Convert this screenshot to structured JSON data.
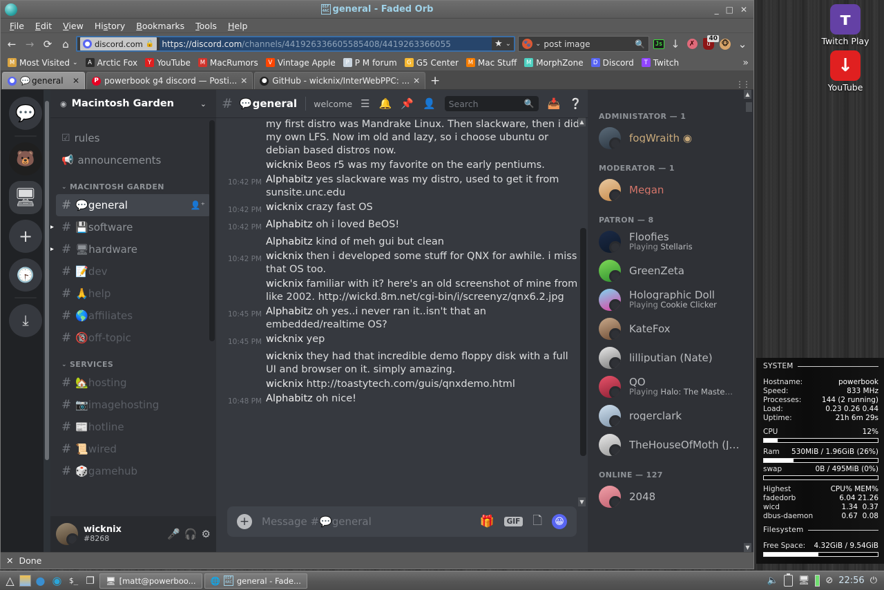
{
  "desktop": {
    "icons": [
      {
        "label": "Twitch Play",
        "icon": "twitch-icon",
        "glyph": "ᴛ"
      },
      {
        "label": "YouTube",
        "icon": "youtube-download-icon",
        "glyph": "↓"
      }
    ]
  },
  "sysmon": {
    "section_system": "SYSTEM",
    "rows": [
      {
        "k": "Hostname:",
        "v": "powerbook"
      },
      {
        "k": "Speed:",
        "v": "833 MHz"
      },
      {
        "k": "Processes:",
        "v": "144 (2 running)"
      },
      {
        "k": "Load:",
        "v": "0.23 0.26 0.44"
      },
      {
        "k": "Uptime:",
        "v": "21h 6m 29s"
      }
    ],
    "cpu_label": "CPU",
    "cpu_value": "12%",
    "cpu_pct": 12,
    "ram_label": "Ram",
    "ram_value": "530MiB / 1.96GiB (26%)",
    "ram_pct": 26,
    "swap_label": "swap",
    "swap_value": "0B / 495MiB (0%)",
    "swap_pct": 0,
    "highest_label": "Highest",
    "highest_cols": "CPU% MEM%",
    "procs": [
      {
        "name": "fadedorb",
        "cpu": "6.04",
        "mem": "21.26"
      },
      {
        "name": "wicd",
        "cpu": "1.34",
        "mem": "0.37"
      },
      {
        "name": "dbus-daemon",
        "cpu": "0.67",
        "mem": "0.08"
      }
    ],
    "section_fs": "Filesystem",
    "free_label": "Free Space:",
    "free_value": "4.32GiB / 9.54GiB",
    "free_pct": 48
  },
  "window": {
    "title": "general - Faded Orb",
    "title_code_top": "01F",
    "title_code_bot": "4AC",
    "minimize": "_",
    "maximize": "□",
    "close": "✕"
  },
  "menubar": {
    "items": [
      {
        "label": "File",
        "accel": "F"
      },
      {
        "label": "Edit",
        "accel": "E"
      },
      {
        "label": "View",
        "accel": "V"
      },
      {
        "label": "History",
        "accel": "s"
      },
      {
        "label": "Bookmarks",
        "accel": "B"
      },
      {
        "label": "Tools",
        "accel": "T"
      },
      {
        "label": "Help",
        "accel": "H"
      }
    ]
  },
  "navbar": {
    "back": "←",
    "forward": "→",
    "reload": "⟳",
    "home": "⌂",
    "site_label": "discord.com",
    "lock_icon": "padlock-icon",
    "url_host": "https://discord.com",
    "url_path": "/channels/441926336605585408/4419263366055",
    "star": "★",
    "dropdown": "⌄",
    "search_value": "post image",
    "search_engine": "duckduckgo-icon",
    "search_icon": "🔍",
    "extensions": [
      {
        "name": "greasemonkey-js-icon",
        "label": "Js"
      },
      {
        "name": "download-arrow-icon",
        "label": "↓"
      },
      {
        "name": "noscript-icon",
        "label": ""
      },
      {
        "name": "ublock-origin-icon",
        "label": "u",
        "badge": "40"
      },
      {
        "name": "monkey-extension-icon",
        "label": ""
      }
    ],
    "overflow": "⌄"
  },
  "bookmarks": [
    {
      "label": "Most Visited",
      "icon": "folder-star-icon",
      "color": "#d9a441",
      "chev": "⌄"
    },
    {
      "label": "Arctic Fox",
      "icon": "arcticfox-icon",
      "color": "#2b2b2b"
    },
    {
      "label": "YouTube",
      "icon": "youtube-icon",
      "color": "#e02020"
    },
    {
      "label": "MacRumors",
      "icon": "macrumors-icon",
      "color": "#d0342c"
    },
    {
      "label": "Vintage Apple",
      "icon": "reddit-icon",
      "color": "#ff4500"
    },
    {
      "label": "P M forum",
      "icon": "powermac-forum-icon",
      "color": "#c9d4de"
    },
    {
      "label": "G5 Center",
      "icon": "g5-center-icon",
      "color": "#f5b731"
    },
    {
      "label": "Mac Stuff",
      "icon": "blogger-icon",
      "color": "#f57c00"
    },
    {
      "label": "MorphZone",
      "icon": "morphzone-icon",
      "color": "#4dd0c0"
    },
    {
      "label": "Discord",
      "icon": "discord-icon",
      "color": "#5865f2"
    },
    {
      "label": "Twitch",
      "icon": "twitch-icon",
      "color": "#9146ff"
    }
  ],
  "bookmarks_overflow": "»",
  "tabs": {
    "items": [
      {
        "label": "general",
        "favicon": "discord-icon",
        "active": true,
        "emoji": "💬"
      },
      {
        "label": "powerbook g4 discord — Posti...",
        "favicon": "pinterest-icon",
        "active": false
      },
      {
        "label": "GitHub - wicknix/InterWebPPC: ...",
        "favicon": "github-icon",
        "active": false
      }
    ],
    "close": "✕",
    "new_tab": "+"
  },
  "discord": {
    "rail": [
      {
        "name": "home-button",
        "icon": "discord-logo-icon"
      },
      {
        "name": "guild-macyn",
        "icon": "macyn-server-icon"
      },
      {
        "name": "guild-macintosh-garden",
        "icon": "macintosh-garden-server-icon",
        "selected": true
      },
      {
        "name": "add-server-button",
        "icon": "plus-icon",
        "glyph": "+"
      },
      {
        "name": "explore-servers-button",
        "icon": "compass-icon",
        "glyph": "⦿"
      },
      {
        "name": "download-apps-button",
        "icon": "download-icon",
        "glyph": "⤓"
      }
    ],
    "guild_name": "Macintosh Garden",
    "guild_chevron": "⌄",
    "top_channels": [
      {
        "label": "rules",
        "icon": "rules-checkbox-icon"
      },
      {
        "label": "announcements",
        "icon": "megaphone-icon"
      }
    ],
    "categories": [
      {
        "name": "MACINTOSH GARDEN",
        "channels": [
          {
            "label": "general",
            "emoji": "💬",
            "active": true,
            "locked": false,
            "add": "👤⁺"
          },
          {
            "label": "software",
            "emoji": "💾",
            "active": false,
            "locked": false,
            "arrow": true
          },
          {
            "label": "hardware",
            "emoji": "🖥",
            "active": false,
            "locked": false,
            "arrow": true
          },
          {
            "label": "dev",
            "emoji": "📝",
            "active": false,
            "locked": true
          },
          {
            "label": "help",
            "emoji": "🙏",
            "active": false,
            "locked": true
          },
          {
            "label": "affiliates",
            "emoji": "🌎",
            "active": false,
            "locked": true
          },
          {
            "label": "off-topic",
            "emoji": "🔞",
            "active": false,
            "locked": true
          }
        ]
      },
      {
        "name": "SERVICES",
        "channels": [
          {
            "label": "hosting",
            "emoji": "🏡",
            "active": false,
            "locked": true
          },
          {
            "label": "imagehosting",
            "emoji": "📷",
            "active": false,
            "locked": true
          },
          {
            "label": "hotline",
            "emoji": "📰",
            "active": false,
            "locked": true
          },
          {
            "label": "wired",
            "emoji": "📜",
            "active": false,
            "locked": true
          },
          {
            "label": "gamehub",
            "emoji": "🎲",
            "active": false,
            "locked": true
          }
        ]
      }
    ],
    "user_panel": {
      "name": "wicknix",
      "discriminator": "#8268",
      "mute_icon": "microphone-muted-icon",
      "deafen_icon": "headphones-muted-icon",
      "settings_icon": "gear-icon"
    },
    "channel_header": {
      "hash": "#",
      "name": "general",
      "emoji": "💬",
      "topic": "welcome to the general (mac) chat!",
      "icons": [
        {
          "name": "threads-icon"
        },
        {
          "name": "notification-bell-icon"
        },
        {
          "name": "pinned-messages-icon"
        },
        {
          "name": "member-list-icon"
        }
      ],
      "search_placeholder": "Search",
      "inbox_icon": "inbox-icon",
      "help_icon": "help-icon"
    },
    "messages": [
      {
        "ts": "",
        "author": "",
        "cont": true,
        "text": "my first distro was Mandrake Linux. Then slackware, then i did my own LFS. Now im old and lazy, so i choose ubuntu or debian based distros now."
      },
      {
        "ts": "",
        "author": "wicknix",
        "text": "Beos r5 was my favorite on the early pentiums."
      },
      {
        "ts": "10:42 PM",
        "author": "Alphabitz",
        "text": "yes slackware was my distro, used to get it from sunsite.unc.edu"
      },
      {
        "ts": "10:42 PM",
        "author": "wicknix",
        "text": "crazy fast OS"
      },
      {
        "ts": "10:42 PM",
        "author": "Alphabitz",
        "text": "oh i loved BeOS!"
      },
      {
        "ts": "",
        "author": "Alphabitz",
        "text": "kind of meh gui but clean"
      },
      {
        "ts": "10:42 PM",
        "author": "wicknix",
        "text": "then i developed some stuff for QNX for awhile. i miss that OS too."
      },
      {
        "ts": "",
        "author": "wicknix",
        "text": "familiar with it? here's an old screenshot of mine from like 2002. http://wickd.8m.net/cgi-bin/i/screenyz/qnx6.2.jpg"
      },
      {
        "ts": "10:45 PM",
        "author": "Alphabitz",
        "text": "oh yes..i never ran it..isn't that an embedded/realtime OS?"
      },
      {
        "ts": "10:45 PM",
        "author": "wicknix",
        "text": "yep"
      },
      {
        "ts": "",
        "author": "wicknix",
        "text": "they had that incredible demo floppy disk with a full UI and browser on it. simply amazing."
      },
      {
        "ts": "",
        "author": "wicknix",
        "text": "http://toastytech.com/guis/qnxdemo.html"
      },
      {
        "ts": "10:48 PM",
        "author": "Alphabitz",
        "text": "oh nice!"
      }
    ],
    "composer": {
      "placeholder_prefix": "Message #",
      "placeholder_emoji": "💬",
      "placeholder_channel": "general",
      "plus": "+",
      "gift_icon": "gift-icon",
      "gif_label": "GIF",
      "sticker_icon": "sticker-icon",
      "emoji_icon": "emoji-icon"
    },
    "member_groups": [
      {
        "title": "ADMINISTATOR — 1",
        "members": [
          {
            "name": "fogWraith",
            "role": "admin",
            "badge": "◉",
            "avatar": "av-fog"
          }
        ]
      },
      {
        "title": "MODERATOR — 1",
        "members": [
          {
            "name": "Megan",
            "role": "mod",
            "avatar": "av-meg"
          }
        ]
      },
      {
        "title": "PATRON — 8",
        "members": [
          {
            "name": "Floofies",
            "activity_prefix": "Playing ",
            "activity": "Stellaris",
            "avatar": "av-flo"
          },
          {
            "name": "GreenZeta",
            "avatar": "av-grn"
          },
          {
            "name": "Holographic Doll",
            "activity_prefix": "Playing ",
            "activity": "Cookie Clicker",
            "avatar": "av-hol"
          },
          {
            "name": "KateFox",
            "avatar": "av-kat"
          },
          {
            "name": "lilliputian (Nate)",
            "avatar": "av-lil"
          },
          {
            "name": "QO",
            "activity_prefix": "Playing ",
            "activity": "Halo: The Master Chi...",
            "avatar": "av-q0"
          },
          {
            "name": "rogerclark",
            "avatar": "av-rog"
          },
          {
            "name": "TheHouseOfMoth (Ja...",
            "avatar": "av-moth"
          }
        ]
      },
      {
        "title": "ONLINE — 127",
        "members": [
          {
            "name": "2048",
            "avatar": "av-2048"
          }
        ]
      }
    ]
  },
  "statusbar": {
    "close": "✕",
    "text": "Done"
  },
  "taskbar": {
    "launchers": [
      {
        "name": "menu-icon",
        "glyph": "▲"
      },
      {
        "name": "file-manager-icon",
        "glyph": "▬"
      },
      {
        "name": "bird-browser-icon",
        "glyph": "◕"
      },
      {
        "name": "firefox-icon",
        "glyph": "◎"
      },
      {
        "name": "terminal-icon",
        "glyph": "$_"
      },
      {
        "name": "windows-icon",
        "glyph": "❐"
      }
    ],
    "windows": [
      {
        "label": "[matt@powerboo...",
        "icon": "terminal-window-icon"
      },
      {
        "label": "general - Fade...",
        "icon": "browser-window-icon"
      }
    ],
    "tray": {
      "volume_icon": "volume-icon",
      "battery_icon": "battery-icon",
      "monitor_icon": "monitor-icon",
      "notify_icon": "do-not-disturb-icon",
      "clock": "22:56",
      "power_icon": "power-icon"
    }
  }
}
